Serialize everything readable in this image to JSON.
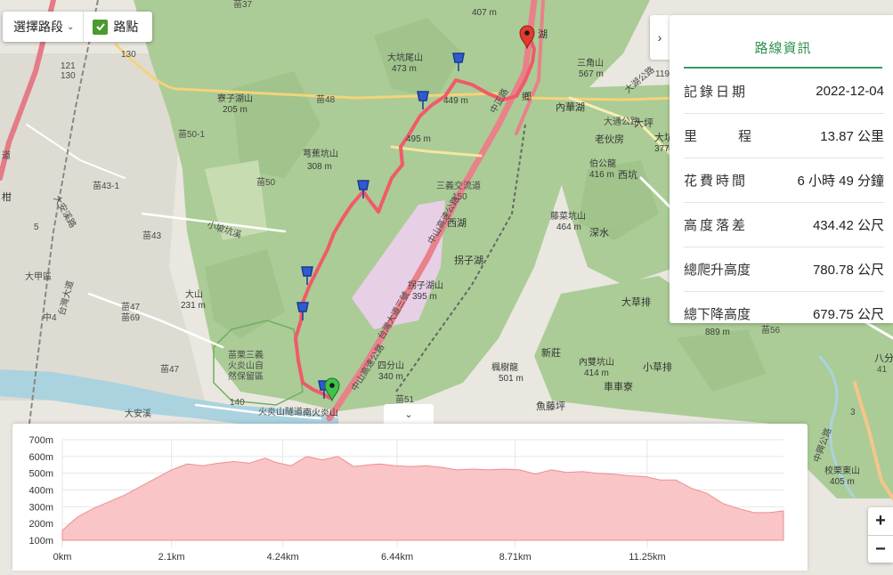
{
  "controls": {
    "route_select_label": "選擇路段",
    "waypoint_label": "路點"
  },
  "panel": {
    "tab_title": "路線資訊",
    "rows": [
      {
        "label": "記錄日期",
        "value": "2022-12-04"
      },
      {
        "label": "里程",
        "value": "13.87 公里"
      },
      {
        "label": "花費時間",
        "value": "6 小時 49 分鐘"
      },
      {
        "label": "高度落差",
        "value": "434.42 公尺"
      },
      {
        "label": "總爬升高度",
        "value": "780.78 公尺"
      },
      {
        "label": "總下降高度",
        "value": "679.75 公尺"
      }
    ]
  },
  "map": {
    "colors": {
      "land": "#e9e7e0",
      "forest": "#aacb95",
      "forest_dark": "#9cc287",
      "urban": "#d9d5cc",
      "river": "#aad3df",
      "route": "#f05a6a",
      "highway": "#e8818a",
      "railway": "#777777"
    },
    "labels": {
      "l1": "苗37",
      "l2": "大坑尾山",
      "l3": "473 m",
      "l4": "三角山",
      "l5": "567 m",
      "l6": "121",
      "l7": "130",
      "l8": "130",
      "l9": "寮子湖山",
      "l10": "205 m",
      "l11": "苗48",
      "l12": "449 m",
      "l13": "鄉",
      "l14": "內華湖",
      "l15": "大坪",
      "l16": "苗50-1",
      "l17": "老伙房",
      "l18": "芎蕉坑山",
      "l19": "308 m",
      "l20": "495 m",
      "l21": "伯公龍",
      "l22": "416 m",
      "l23": "西坑",
      "l24": "苗43-1",
      "l25": "苗50",
      "l26": "三義交流道",
      "l27": "150",
      "l28": "西湖",
      "l29": "藤菜坑山",
      "l30": "464 m",
      "l31": "深水",
      "l32": "苗43",
      "l33": "大甲區",
      "l34": "拐子湖",
      "l35": "拐子湖山",
      "l36": "395 m",
      "l37": "大山",
      "l38": "231 m",
      "l39": "大草排",
      "l40": "中4",
      "l41": "苗47",
      "l42": "苗69",
      "l43": "苗56",
      "l44": "新莊",
      "l45": "苗栗三義",
      "l46": "火炎山自",
      "l47": "然保留區",
      "l48": "苗47",
      "l49": "四分山",
      "l50": "340 m",
      "l51": "楓樹龍",
      "l52": "501 m",
      "l53": "內雙坑山",
      "l54": "414 m",
      "l55": "小草排",
      "l56": "車車寮",
      "l57": "140",
      "l58": "火炎山隧道",
      "l59": "南火炎山",
      "l60": "苗51",
      "l61": "魚藤坪",
      "l62": "大安溪",
      "l63": "3",
      "l64": "校栗東山",
      "l65": "405 m",
      "l66": "119",
      "l67": "407 m",
      "l68": "889 m",
      "l69": "377",
      "l70": "大坑",
      "l71": "湖",
      "l72": "中山高速公路",
      "l73": "台灣大道",
      "l74": "八分",
      "l75": "41",
      "l76": "5",
      "l77": "道",
      "l78": "柑",
      "l79": "大湖公路",
      "l80": "大通公路",
      "l81": "大安溪路",
      "l82": "中正路",
      "l83": "中山高速公路",
      "l84": "小坡坑溪",
      "l85": "中興公路",
      "l86": "台灣大道三號"
    }
  },
  "profile": {
    "y_ticks": [
      "700m",
      "600m",
      "500m",
      "400m",
      "300m",
      "200m",
      "100m"
    ],
    "x_ticks": [
      "0km",
      "2.1km",
      "4.24km",
      "6.44km",
      "8.71km",
      "11.25km"
    ]
  },
  "chart_data": {
    "type": "area",
    "title": "",
    "xlabel": "",
    "ylabel": "",
    "x_unit": "km",
    "y_unit": "m",
    "xlim": [
      0,
      13.87
    ],
    "ylim": [
      100,
      700
    ],
    "grid": true,
    "series": [
      {
        "x": [
          0,
          0.3,
          0.6,
          0.9,
          1.2,
          1.5,
          1.8,
          2.1,
          2.4,
          2.7,
          3.0,
          3.3,
          3.6,
          3.9,
          4.1,
          4.4,
          4.7,
          5.0,
          5.3,
          5.6,
          5.9,
          6.1,
          6.4,
          6.7,
          7.0,
          7.3,
          7.6,
          7.9,
          8.2,
          8.5,
          8.8,
          9.1,
          9.4,
          9.7,
          10.0,
          10.3,
          10.6,
          10.9,
          11.2,
          11.5,
          11.8,
          12.1,
          12.4,
          12.7,
          13.0,
          13.3,
          13.6,
          13.87
        ],
        "y": [
          160,
          240,
          290,
          330,
          370,
          420,
          470,
          520,
          555,
          545,
          560,
          570,
          560,
          590,
          565,
          545,
          600,
          580,
          600,
          540,
          550,
          555,
          545,
          540,
          545,
          535,
          520,
          525,
          520,
          525,
          520,
          495,
          520,
          505,
          510,
          500,
          495,
          485,
          480,
          460,
          460,
          410,
          380,
          320,
          290,
          265,
          265,
          275
        ]
      }
    ]
  },
  "zoom": {
    "in": "+",
    "out": "−"
  },
  "collapse_icon": "⌄",
  "panel_toggle_icon": "›"
}
